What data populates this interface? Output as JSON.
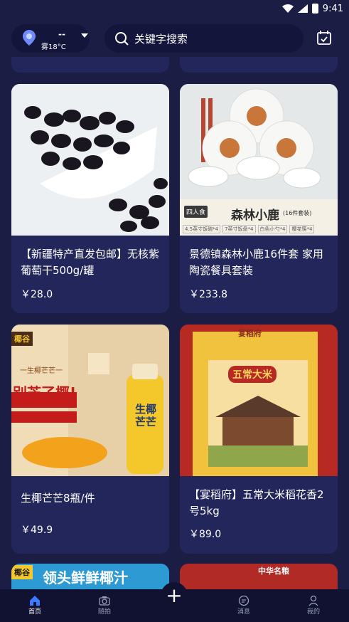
{
  "status_bar": {
    "time": "9:41"
  },
  "header": {
    "location_label": "--",
    "weather": "雾18°C",
    "search_placeholder": "关键字搜索"
  },
  "products": [
    {
      "title": "【新疆特产直发包邮】无核紫葡萄干500g/罐",
      "price": "￥28.0"
    },
    {
      "title": "景德镇森林小鹿16件套 家用陶瓷餐具套装",
      "price": "￥233.8"
    },
    {
      "title": "生椰芒芒8瓶/件",
      "price": "￥49.9"
    },
    {
      "title": "【宴稻府】五常大米稻花香2号5kg",
      "price": "￥89.0"
    }
  ],
  "product_images": {
    "plate_banner_text": "森林小鹿",
    "plate_sub_label": "四人食",
    "plate_set_label": "(16件套装)",
    "plate_items": [
      "4.5英寸饭碗*4",
      "7英寸饭盘*4",
      "白色小勺*4",
      "樱花筷*4"
    ],
    "coconut_brand": "椰谷",
    "coconut_slogan": "别芒了椰!",
    "coconut_bottle_label": "生椰芒芒",
    "coconut_sub": "一生椰芒芒一",
    "rice_brand": "宴稻府",
    "rice_name": "五常大米"
  },
  "partial_cards": {
    "left_text": "领头鲜鲜椰汁",
    "left_brand": "椰谷",
    "right_text": "中华名粮"
  },
  "tab_bar": {
    "tabs": [
      {
        "label": "首页",
        "icon": "home-icon"
      },
      {
        "label": "随拍",
        "icon": "camera-icon"
      },
      {
        "label": "消息",
        "icon": "message-icon"
      },
      {
        "label": "我的",
        "icon": "user-icon"
      }
    ],
    "fab_icon": "plus-icon",
    "fab_glyph": "+"
  },
  "colors": {
    "background": "#1c1d45",
    "card": "#23265a",
    "tab_bar": "#111232",
    "accent": "#3a7bff"
  }
}
